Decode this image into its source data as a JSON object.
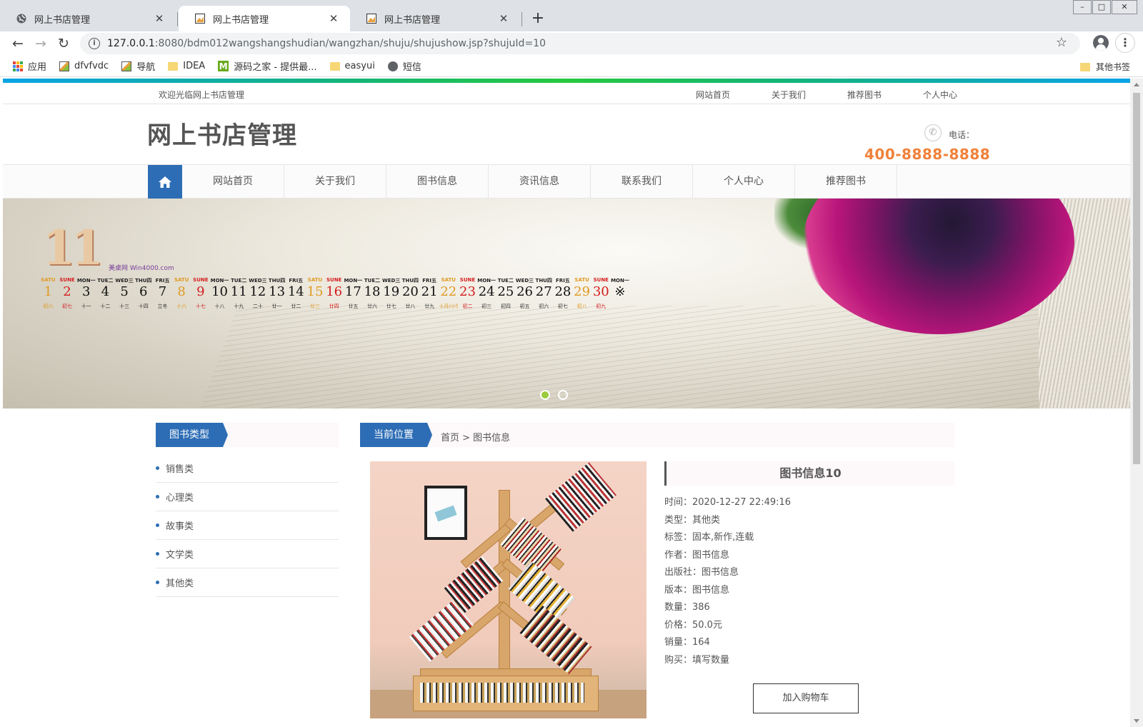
{
  "browser": {
    "tabs": [
      {
        "title": "网上书店管理",
        "favicon": "globe-icon",
        "active": false
      },
      {
        "title": "网上书店管理",
        "favicon": "image-icon",
        "active": true
      },
      {
        "title": "网上书店管理",
        "favicon": "image-icon",
        "active": false
      }
    ],
    "close_glyph": "✕",
    "new_tab_glyph": "+",
    "url_host": "127.0.0.1",
    "url_rest": ":8080/bdm012wangshangshudian/wangzhan/shuju/shujushow.jsp?shujuId=10",
    "bookmarks": [
      {
        "label": "应用",
        "icon": "apps-grid-icon"
      },
      {
        "label": "dfvfvdc",
        "icon": "image-icon"
      },
      {
        "label": "导航",
        "icon": "image-icon"
      },
      {
        "label": "IDEA",
        "icon": "folder-icon"
      },
      {
        "label": "源码之家 - 提供最...",
        "icon": "m-logo-icon"
      },
      {
        "label": "easyui",
        "icon": "folder-icon"
      },
      {
        "label": "短信",
        "icon": "globe-icon"
      }
    ],
    "other_bookmarks": "其他书签"
  },
  "site": {
    "welcome": "欢迎光临网上书店管理",
    "top_links": [
      "网站首页",
      "关于我们",
      "推荐图书",
      "个人中心"
    ],
    "title": "网上书店管理",
    "phone_label": "电话：",
    "phone_number": "400-8888-8888",
    "nav": [
      "网站首页",
      "关于我们",
      "图书信息",
      "资讯信息",
      "联系我们",
      "个人中心",
      "推荐图书"
    ],
    "colors": {
      "primary": "#2d6db5",
      "phone": "#f0813a",
      "active_dot": "#9ccc3c"
    }
  },
  "banner": {
    "month": "11",
    "brand": "美桌网 Win4000.com",
    "weekdays": [
      "SATU",
      "SUNE",
      "MON一",
      "TUE二",
      "WED三",
      "THU四",
      "FRI五",
      "SATU",
      "SUNE",
      "MON一",
      "TUE二",
      "WED三",
      "THU四",
      "FRI五",
      "SATU",
      "SUNE",
      "MON一",
      "TUE二",
      "WED三",
      "THU四",
      "FRI五",
      "SATU",
      "SUNE",
      "MON一",
      "TUE二",
      "WED三",
      "THU四",
      "FRI五",
      "SATU",
      "SUNE",
      "MON一"
    ],
    "days": [
      "1",
      "2",
      "3",
      "4",
      "5",
      "6",
      "7",
      "8",
      "9",
      "10",
      "11",
      "12",
      "13",
      "14",
      "15",
      "16",
      "17",
      "18",
      "19",
      "20",
      "21",
      "22",
      "23",
      "24",
      "25",
      "26",
      "27",
      "28",
      "29",
      "30",
      "※"
    ],
    "lunar": [
      "初六",
      "初七",
      "十一",
      "十二",
      "十三",
      "十四",
      "立冬",
      "十六",
      "十七",
      "十八",
      "十九",
      "二十",
      "廿一",
      "廿二",
      "廿三",
      "廿四",
      "廿五",
      "廿六",
      "廿七",
      "廿八",
      "廿九",
      "十月/小雪",
      "初二",
      "初三",
      "初四",
      "初五",
      "初六",
      "初七",
      "初八",
      "初九",
      ""
    ],
    "slide_count": 2,
    "active_slide": 1
  },
  "sidebar": {
    "heading": "图书类型",
    "categories": [
      "销售类",
      "心理类",
      "故事类",
      "文学类",
      "其他类"
    ]
  },
  "breadcrumb": {
    "label": "当前位置",
    "path": "首页 > 图书信息"
  },
  "book": {
    "title": "图书信息10",
    "fields": [
      "时间：2020-12-27 22:49:16",
      "类型：其他类",
      "标签：固本,新作,连载",
      "作者：图书信息",
      "出版社：图书信息",
      "版本：图书信息",
      "数量：386",
      "价格：50.0元",
      "销量：164",
      "购买：填写数量"
    ],
    "add_to_cart": "加入购物车"
  }
}
